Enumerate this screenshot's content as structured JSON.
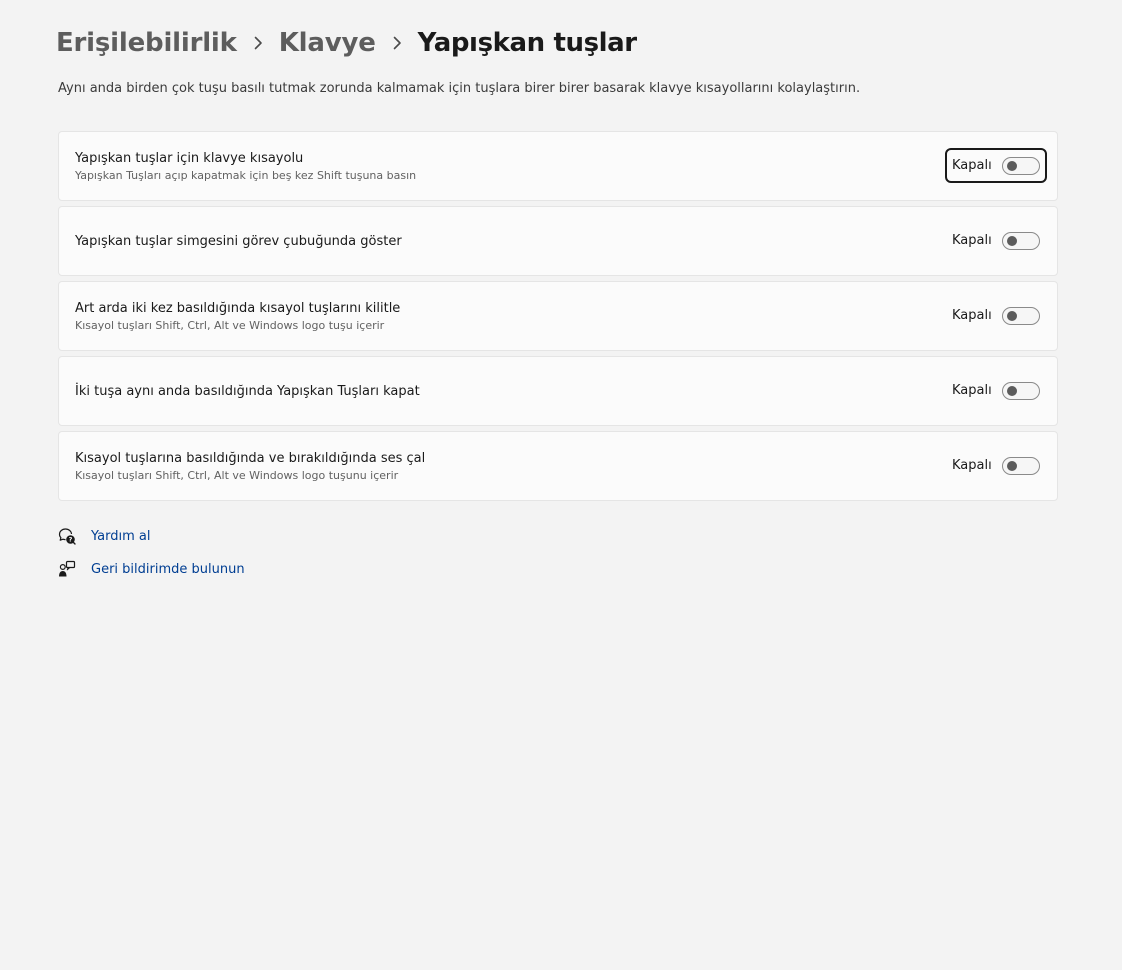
{
  "breadcrumb": {
    "items": [
      "Erişilebilirlik",
      "Klavye",
      "Yapışkan tuşlar"
    ]
  },
  "description": "Aynı anda birden çok tuşu basılı tutmak zorunda kalmamak için tuşlara birer birer basarak klavye kısayollarını kolaylaştırın.",
  "settings": [
    {
      "title": "Yapışkan tuşlar için klavye kısayolu",
      "subtitle": "Yapışkan Tuşları açıp kapatmak için beş kez Shift tuşuna basın",
      "state_label": "Kapalı",
      "on": false,
      "focused": true
    },
    {
      "title": "Yapışkan tuşlar simgesini görev çubuğunda göster",
      "subtitle": "",
      "state_label": "Kapalı",
      "on": false,
      "focused": false
    },
    {
      "title": "Art arda iki kez basıldığında kısayol tuşlarını kilitle",
      "subtitle": "Kısayol tuşları Shift, Ctrl, Alt ve Windows logo tuşu içerir",
      "state_label": "Kapalı",
      "on": false,
      "focused": false
    },
    {
      "title": "İki tuşa aynı anda basıldığında Yapışkan Tuşları kapat",
      "subtitle": "",
      "state_label": "Kapalı",
      "on": false,
      "focused": false
    },
    {
      "title": "Kısayol tuşlarına basıldığında ve bırakıldığında ses çal",
      "subtitle": "Kısayol tuşları Shift, Ctrl, Alt ve Windows logo tuşunu içerir",
      "state_label": "Kapalı",
      "on": false,
      "focused": false
    }
  ],
  "links": [
    {
      "label": "Yardım al",
      "icon": "help-chat-icon"
    },
    {
      "label": "Geri bildirimde bulunun",
      "icon": "feedback-icon"
    }
  ],
  "colors": {
    "background": "#f3f3f3",
    "card": "#fbfbfb",
    "link": "#003e92"
  }
}
